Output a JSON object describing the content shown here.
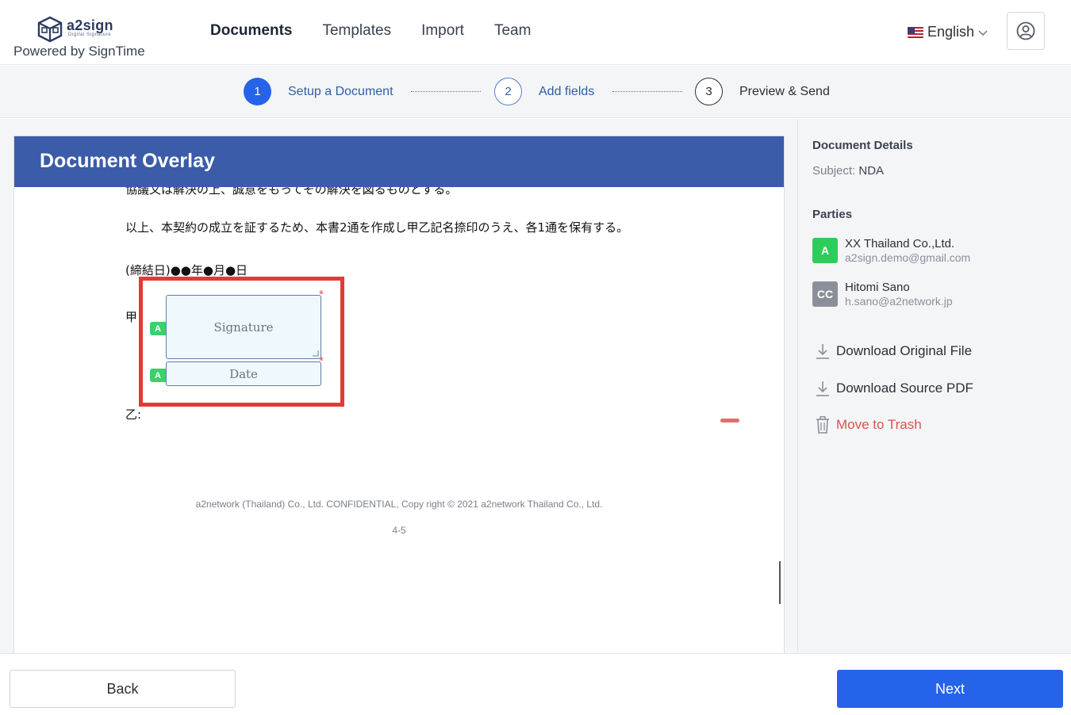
{
  "header": {
    "logo_name": "a2sign",
    "logo_tagline": "Digital Signature",
    "powered_by": "Powered by SignTime",
    "nav": [
      "Documents",
      "Templates",
      "Import",
      "Team"
    ],
    "active_nav": "Documents",
    "language": "English"
  },
  "stepper": {
    "steps": [
      {
        "num": "1",
        "label": "Setup a Document",
        "state": "active"
      },
      {
        "num": "2",
        "label": "Add fields",
        "state": "pending"
      },
      {
        "num": "3",
        "label": "Preview & Send",
        "state": "pending"
      }
    ]
  },
  "document": {
    "overlay_title": "Document Overlay",
    "cut_line": "協議又は解決の上、誠意をもってその解決を図るものとする。",
    "line1": "以上、本契約の成立を証するため、本書2通を作成し甲乙記名捺印のうえ、各1通を保有する。",
    "line2": "(締結日)●●年●月●日",
    "party_a_label": "甲",
    "party_b_label": "乙:",
    "fields": [
      {
        "tag": "A",
        "label": "Signature",
        "required": true
      },
      {
        "tag": "A",
        "label": "Date",
        "required": true
      }
    ],
    "required_mark": "*",
    "footer": "a2network (Thailand) Co., Ltd. CONFIDENTIAL, Copy right © 2021 a2network Thailand Co., Ltd.",
    "page_label": "4-5"
  },
  "sidebar": {
    "details_title": "Document Details",
    "subject_key": "Subject:",
    "subject_value": "NDA",
    "parties_title": "Parties",
    "parties": [
      {
        "badge": "A",
        "name": "XX Thailand Co.,Ltd.",
        "email": "a2sign.demo@gmail.com",
        "color": "#2ecc5a"
      },
      {
        "badge": "CC",
        "name": "Hitomi Sano",
        "email": "h.sano@a2network.jp",
        "color": "#8a8f99"
      }
    ],
    "actions": {
      "download_original": "Download Original File",
      "download_pdf": "Download Source PDF",
      "trash": "Move to Trash"
    }
  },
  "footer": {
    "back": "Back",
    "next": "Next"
  },
  "colors": {
    "primary": "#2563eb",
    "overlay_header": "#3b5ca8",
    "highlight": "#e53935",
    "danger": "#d9534f"
  }
}
